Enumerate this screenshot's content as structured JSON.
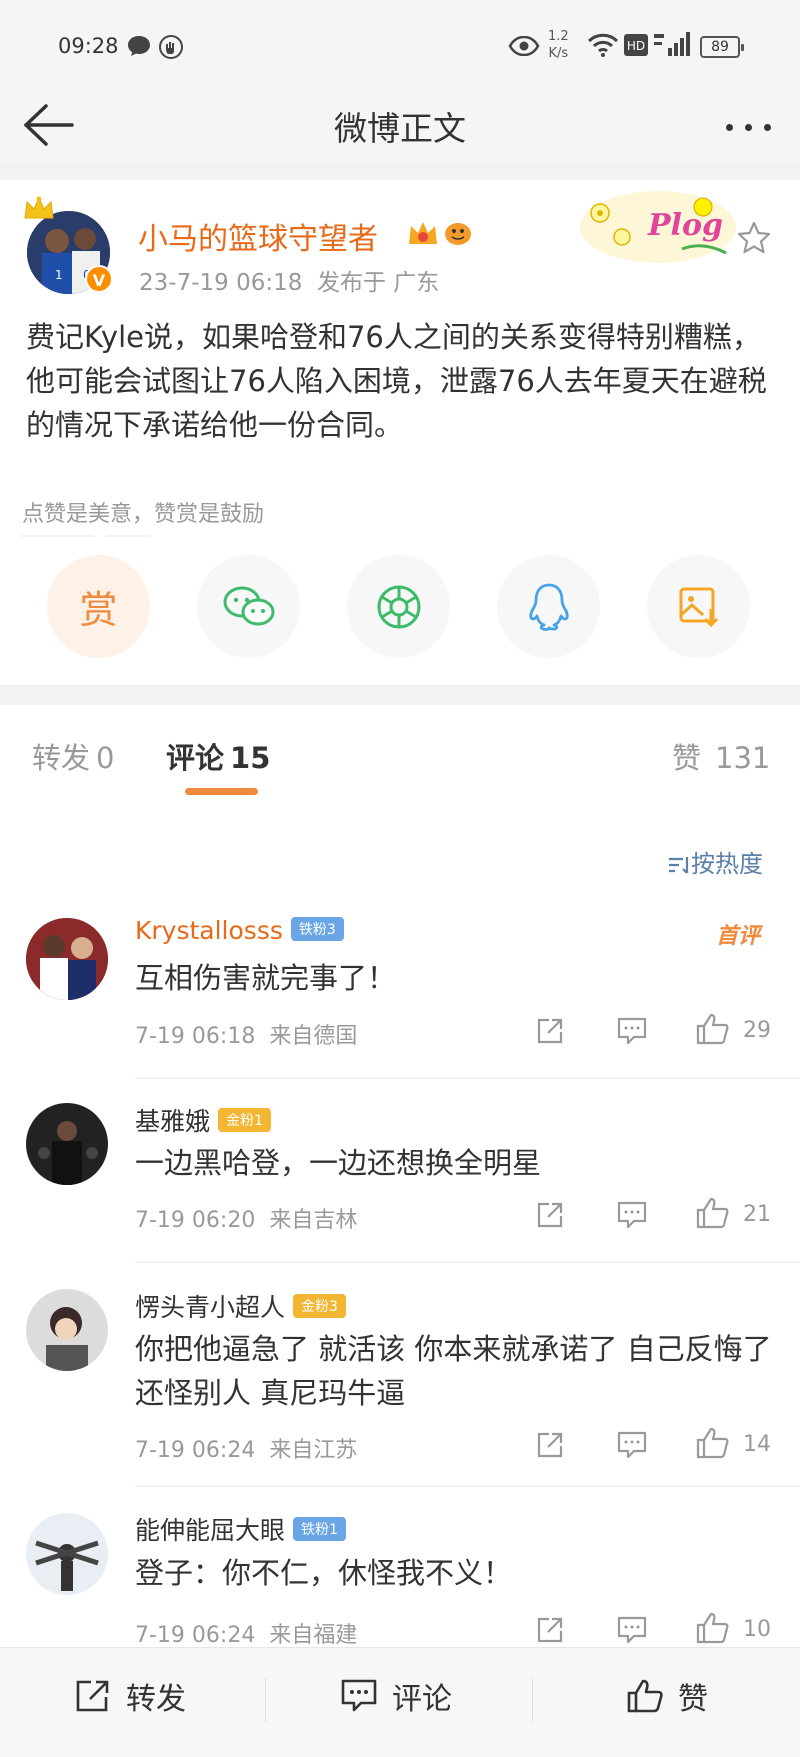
{
  "status_bar": {
    "time": "09:28",
    "net_speed_value": "1.2",
    "net_speed_unit": "K/s",
    "battery": "89",
    "icons": [
      "message-icon",
      "shield-icon",
      "eye-icon",
      "wifi-icon",
      "hd-icon",
      "signal-icon",
      "battery-icon"
    ]
  },
  "nav": {
    "title": "微博正文",
    "back_icon": "back-arrow-icon",
    "more_icon": "more-icon"
  },
  "post": {
    "author": "小马的篮球守望者",
    "time": "23-7-19 06:18",
    "location": "发布于 广东",
    "text": "费记Kyle说，如果哈登和76人之间的关系变得特别糟糕，他可能会试图让76人陷入困境，泄露76人去年夏天在避税的情况下承诺给他一份合同。",
    "verified_mark": "V",
    "plog_label": "Plog",
    "reward_hint": "点赞是美意，赞赏是鼓励",
    "reward_button": "赏",
    "share_buttons": [
      "reward-button",
      "wechat-icon",
      "moments-icon",
      "qq-icon",
      "save-image-icon"
    ]
  },
  "tabs": [
    {
      "label": "转发",
      "count": "0"
    },
    {
      "label": "评论",
      "count": "15"
    },
    {
      "label": "赞",
      "count": "131"
    }
  ],
  "sort_label": "按热度",
  "first_label": "首评",
  "comments": [
    {
      "name": "Krystallosss",
      "badge": "铁粉3",
      "text": "互相伤害就完事了！",
      "time": "7-19 06:18",
      "location": "来自德国",
      "likes": "29"
    },
    {
      "name": "基雅娥",
      "badge": "金粉1",
      "text": "一边黑哈登，一边还想换全明星",
      "time": "7-19 06:20",
      "location": "来自吉林",
      "likes": "21"
    },
    {
      "name": "愣头青小超人",
      "badge": "金粉3",
      "text": "你把他逼急了 就活该 你本来就承诺了 自己反悔了 还怪别人 真尼玛牛逼",
      "time": "7-19 06:24",
      "location": "来自江苏",
      "likes": "14"
    },
    {
      "name": "能伸能屈大眼",
      "badge": "铁粉1",
      "text": "登子：你不仁，休怪我不义！",
      "time": "7-19 06:24",
      "location": "来自福建",
      "likes": "10"
    }
  ],
  "bottom_bar": {
    "repost": "转发",
    "comment": "评论",
    "like": "赞"
  },
  "colors": {
    "accent_orange": "#f08a3c",
    "author_name": "#e86a17",
    "link_blue": "#5a7fa8",
    "iron_badge": "#6aa6e6",
    "gold_badge": "#f2b632"
  }
}
